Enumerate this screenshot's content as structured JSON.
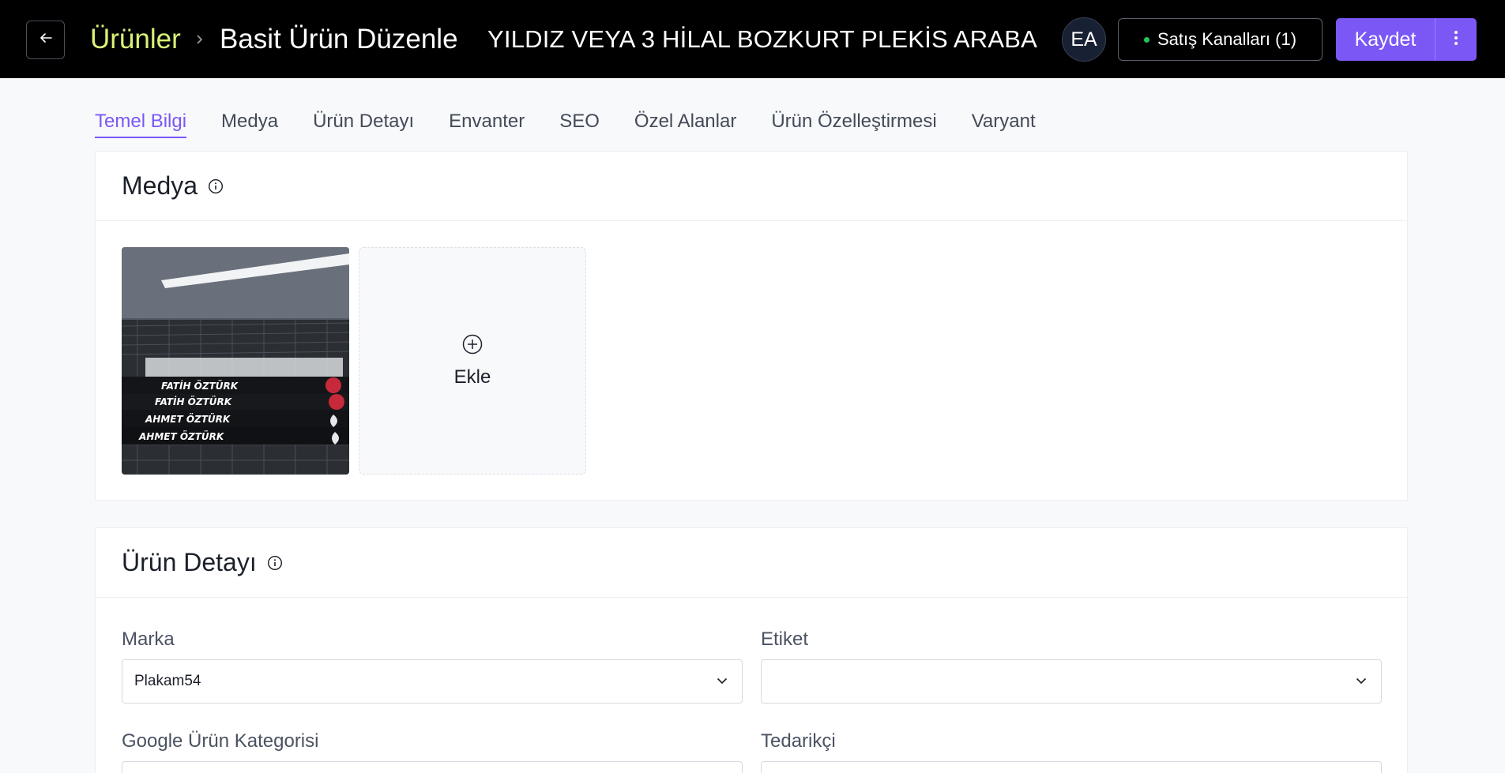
{
  "header": {
    "breadcrumb_root": "Ürünler",
    "breadcrumb_page": "Basit Ürün Düzenle",
    "product_title": "YILDIZ VEYA 3 HİLAL BOZKURT PLEKİS ARABA",
    "avatar_initials": "EA",
    "channels_label": "Satış Kanalları (1)",
    "save_label": "Kaydet",
    "accent_color": "#7b57f6",
    "breadcrumb_color": "#d9f277"
  },
  "tabs": [
    {
      "label": "Temel Bilgi",
      "active": true
    },
    {
      "label": "Medya"
    },
    {
      "label": "Ürün Detayı"
    },
    {
      "label": "Envanter"
    },
    {
      "label": "SEO"
    },
    {
      "label": "Özel Alanlar"
    },
    {
      "label": "Ürün Özelleştirmesi"
    },
    {
      "label": "Varyant"
    }
  ],
  "media": {
    "title": "Medya",
    "images": [
      {
        "plate_texts": [
          "FATİH ÖZTÜRK",
          "FATİH ÖZTÜRK",
          "AHMET ÖZTÜRK",
          "AHMET ÖZTÜRK"
        ]
      }
    ],
    "add_label": "Ekle"
  },
  "product_detail": {
    "title": "Ürün Detayı",
    "fields": {
      "brand": {
        "label": "Marka",
        "value": "Plakam54"
      },
      "tag": {
        "label": "Etiket",
        "value": ""
      },
      "google_category": {
        "label": "Google Ürün Kategorisi",
        "value": ""
      },
      "supplier": {
        "label": "Tedarikçi",
        "value": ""
      }
    }
  }
}
